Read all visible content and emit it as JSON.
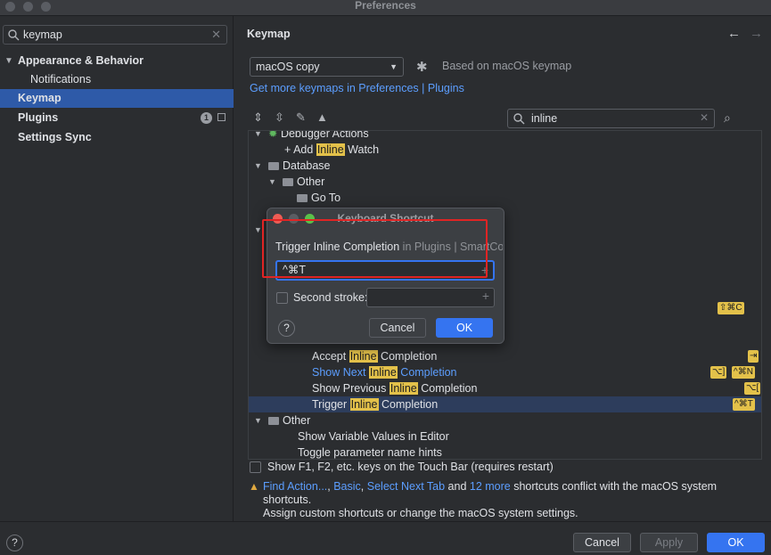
{
  "window": {
    "title": "Preferences"
  },
  "sidebar": {
    "search_value": "keymap",
    "items": [
      {
        "label": "Appearance & Behavior"
      },
      {
        "label": "Notifications"
      },
      {
        "label": "Keymap"
      },
      {
        "label": "Plugins",
        "badge": "1"
      },
      {
        "label": "Settings Sync"
      }
    ]
  },
  "main": {
    "title": "Keymap",
    "keymap_select": "macOS copy",
    "based_on": "Based on macOS keymap",
    "more_link": "Get more keymaps in Preferences | Plugins",
    "filter_value": "inline",
    "tree": [
      {
        "pre": "Debugger Actions",
        "hl": "",
        "post": ""
      },
      {
        "pre": "Add ",
        "hl": "Inline",
        "post": " Watch"
      },
      {
        "pre": "Database",
        "hl": "",
        "post": ""
      },
      {
        "pre": "Other",
        "hl": "",
        "post": ""
      },
      {
        "pre": "Go To",
        "hl": "",
        "post": ""
      },
      {
        "pre": "Accept ",
        "hl": "Inline",
        "post": " Completion",
        "shortcut": "⇥"
      },
      {
        "pre": "Show Next ",
        "hl": "Inline",
        "post": " Completion",
        "shortcut": "⌥]",
        "shortcut2": "^⌘N"
      },
      {
        "pre": "Show Previous ",
        "hl": "Inline",
        "post": " Completion",
        "shortcut": "⌥["
      },
      {
        "pre": "Trigger ",
        "hl": "Inline",
        "post": " Completion",
        "shortcut": "^⌘T"
      },
      {
        "pre": "Other",
        "hl": "",
        "post": ""
      },
      {
        "pre": "Show Variable Values in Editor",
        "hl": "",
        "post": ""
      },
      {
        "pre": "Toggle parameter name hints",
        "hl": "",
        "post": ""
      }
    ],
    "partial_shortcut": "⇧⌘C",
    "touchbar_label": "Show F1, F2, etc. keys on the Touch Bar (requires restart)",
    "warning": {
      "links": [
        "Find Action...",
        "Basic",
        "Select Next Tab",
        "12 more"
      ],
      "sep1": ", ",
      "and": " and ",
      "text1": " shortcuts conflict with the macOS system shortcuts.",
      "text2": "Assign custom shortcuts or change the macOS system settings."
    }
  },
  "dialog": {
    "title": "Keyboard Shortcut",
    "action_name": "Trigger Inline Completion",
    "action_path": " in Plugins | SmartCode",
    "first_stroke": "^⌘T",
    "second_label": "Second stroke:",
    "cancel": "Cancel",
    "ok": "OK"
  },
  "footer": {
    "cancel": "Cancel",
    "apply": "Apply",
    "ok": "OK"
  }
}
